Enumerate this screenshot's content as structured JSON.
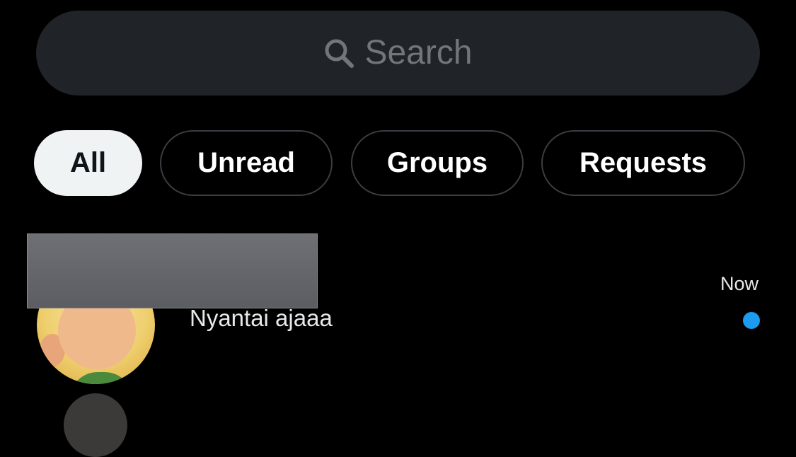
{
  "search": {
    "placeholder": "Search",
    "icon": "search-icon"
  },
  "filters": [
    {
      "label": "All",
      "active": true
    },
    {
      "label": "Unread",
      "active": false
    },
    {
      "label": "Groups",
      "active": false
    },
    {
      "label": "Requests",
      "active": false
    }
  ],
  "conversations": [
    {
      "message_preview": "Nyantai ajaaa",
      "timestamp": "Now",
      "unread": true
    }
  ],
  "colors": {
    "background": "#000000",
    "search_bg": "#202327",
    "active_chip_bg": "#eff3f4",
    "chip_border": "#3a3d41",
    "unread_dot": "#1d9bf0",
    "muted_text": "#71767b"
  }
}
